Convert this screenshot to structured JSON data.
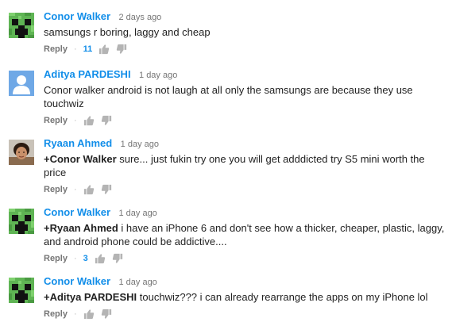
{
  "comments": [
    {
      "author": "Conor Walker",
      "time": "2 days ago",
      "avatar": "creeper-avatar",
      "mention": "",
      "text": "samsungs r boring, laggy and cheap",
      "reply_label": "Reply",
      "separator": "·",
      "likes": "11"
    },
    {
      "author": "Aditya PARDESHI",
      "time": "1 day ago",
      "avatar": "default-person-avatar",
      "mention": "",
      "text": "Conor walker android is not laugh at all only the samsungs are because they use touchwiz",
      "reply_label": "Reply",
      "separator": "·",
      "likes": ""
    },
    {
      "author": "Ryaan Ahmed",
      "time": "1 day ago",
      "avatar": "photo-avatar",
      "mention": "+Conor Walker",
      "text": " sure... just fukin try one you will get adddicted try S5 mini worth the price",
      "reply_label": "Reply",
      "separator": "·",
      "likes": ""
    },
    {
      "author": "Conor Walker",
      "time": "1 day ago",
      "avatar": "creeper-avatar",
      "mention": "+Ryaan Ahmed",
      "text": " i have an iPhone 6 and don't see how a thicker, cheaper, plastic, laggy, and android phone could be addictive....",
      "reply_label": "Reply",
      "separator": "·",
      "likes": "3"
    },
    {
      "author": "Conor Walker",
      "time": "1 day ago",
      "avatar": "creeper-avatar",
      "mention": "+Aditya PARDESHI",
      "text": " touchwiz??? i can already rearrange the apps on my iPhone lol",
      "reply_label": "Reply",
      "separator": "·",
      "likes": ""
    }
  ],
  "colors": {
    "author": "#128ee9",
    "text": "#222222",
    "meta": "#767676",
    "likes": "#128ee9",
    "icon": "#b4b4b4"
  },
  "icons": {
    "like": "thumbs-up-icon",
    "dislike": "thumbs-down-icon"
  }
}
